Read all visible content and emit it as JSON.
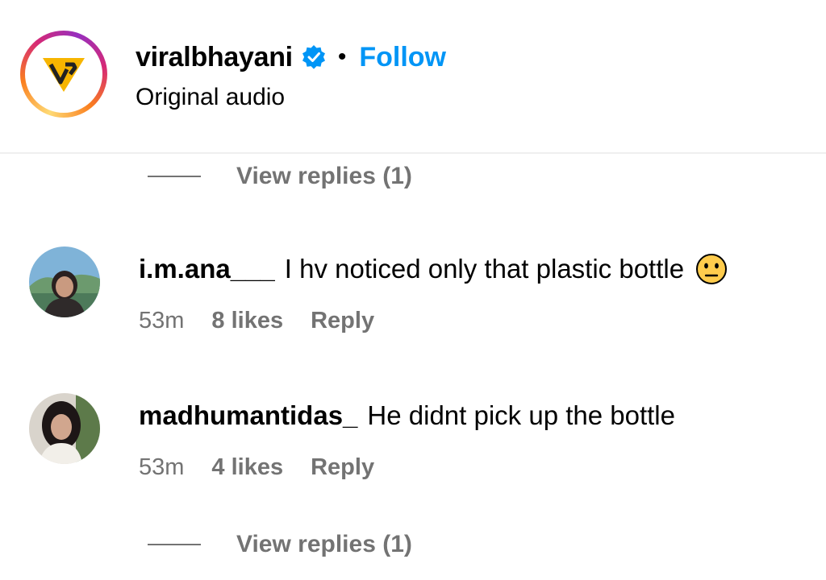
{
  "header": {
    "username": "viralbhayani",
    "separator": "•",
    "follow_label": "Follow",
    "subtitle": "Original audio",
    "avatar_icon": "vb-logo-icon",
    "verified_icon": "verified-badge-icon",
    "colors": {
      "follow": "#0095f6",
      "verified": "#0095f6",
      "logo_yellow": "#f7b500"
    }
  },
  "view_replies_top": {
    "label": "View replies (1)"
  },
  "comments": [
    {
      "username": "i.m.ana___",
      "text": "I hv noticed only that plastic bottle",
      "emoji_icon": "neutral-face-emoji-icon",
      "time": "53m",
      "likes": "8 likes",
      "reply_label": "Reply"
    },
    {
      "username": "madhumantidas_",
      "text": "He didnt pick up the bottle",
      "time": "53m",
      "likes": "4 likes",
      "reply_label": "Reply"
    }
  ],
  "view_replies_bottom": {
    "label": "View replies (1)"
  },
  "colors": {
    "secondary_text": "#737373",
    "divider": "#efefef"
  }
}
